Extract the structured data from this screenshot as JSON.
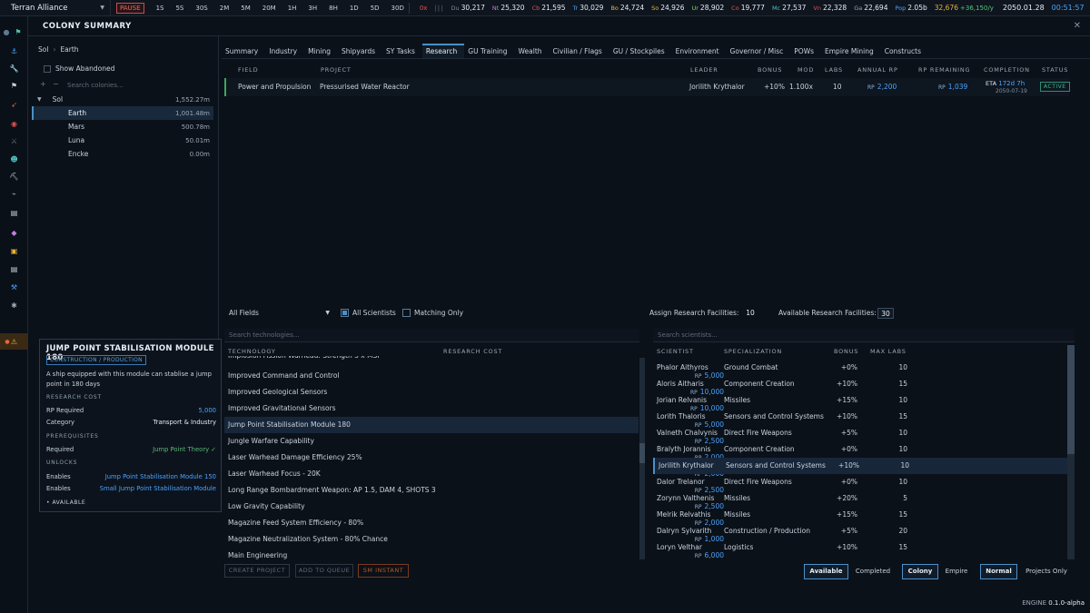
{
  "topbar": {
    "empire": "Terran Alliance",
    "pause": "PAUSE",
    "speeds": [
      "1S",
      "5S",
      "30S",
      "2M",
      "5M",
      "20M",
      "1H",
      "3H",
      "8H",
      "1D",
      "5D",
      "30D"
    ],
    "zero": "0x",
    "resources": [
      {
        "k": "Du",
        "v": "30,217",
        "color": "#7a8a99"
      },
      {
        "k": "Nt",
        "v": "25,320",
        "color": "#c77ddb"
      },
      {
        "k": "Cb",
        "v": "21,595",
        "color": "#e05252"
      },
      {
        "k": "Tr",
        "v": "30,029",
        "color": "#4ba3ff"
      },
      {
        "k": "Bo",
        "v": "24,724",
        "color": "#e8b339"
      },
      {
        "k": "So",
        "v": "24,926",
        "color": "#e8b339"
      },
      {
        "k": "Ur",
        "v": "28,902",
        "color": "#7bd66a"
      },
      {
        "k": "Co",
        "v": "19,777",
        "color": "#e05252"
      },
      {
        "k": "Mc",
        "v": "27,537",
        "color": "#4fc3c3"
      },
      {
        "k": "Vn",
        "v": "22,328",
        "color": "#e05252"
      },
      {
        "k": "Ga",
        "v": "22,694",
        "color": "#9aa8b5"
      },
      {
        "k": "Pop",
        "v": "2.05b",
        "color": "#4ba3ff"
      }
    ],
    "wealth": "32,676",
    "wealth_delta": "+36,150/y",
    "date": "2050.01.28",
    "time": "00:51:57"
  },
  "rail_icons": [
    "circle-icon",
    "flag-icon",
    "anchor-icon",
    "wrench-icon",
    "flag-small-icon",
    "rocket-icon",
    "target-icon",
    "crossed-swords-icon",
    "person-icon",
    "pickaxe-icon",
    "telescope-icon",
    "clipboard-icon",
    "tag-icon",
    "box-icon",
    "clipboard-2-icon",
    "tools-icon",
    "gear-icon",
    "warning-icon"
  ],
  "header": {
    "title": "COLONY SUMMARY",
    "close": "✕"
  },
  "colony": {
    "breadcrumb": [
      "Sol",
      "Earth"
    ],
    "show_abandoned": "Show Abandoned",
    "search_placeholder": "Search colonies...",
    "system": {
      "name": "Sol",
      "pop": "1,552.27m"
    },
    "bodies": [
      {
        "name": "Earth",
        "pop": "1,001.48m"
      },
      {
        "name": "Mars",
        "pop": "500.78m"
      },
      {
        "name": "Luna",
        "pop": "50.01m"
      },
      {
        "name": "Encke",
        "pop": "0.00m"
      }
    ]
  },
  "card": {
    "title": "JUMP POINT STABILISATION MODULE 180",
    "tag": "CONSTRUCTION / PRODUCTION",
    "desc": "A ship equipped with this module can stablise a jump point in 180 days",
    "sec_cost": "RESEARCH COST",
    "rp_label": "RP Required",
    "rp_value": "5,000",
    "cat_label": "Category",
    "cat_value": "Transport & Industry",
    "sec_prereq": "PREREQUISITES",
    "req_label": "Required",
    "req_value": "Jump Point Theory ✓",
    "sec_unlocks": "UNLOCKS",
    "enables": [
      {
        "label": "Enables",
        "value": "Jump Point Stabilisation Module 150"
      },
      {
        "label": "Enables",
        "value": "Small Jump Point Stabilisation Module"
      }
    ],
    "status": "AVAILABLE"
  },
  "tabs": [
    "Summary",
    "Industry",
    "Mining",
    "Shipyards",
    "SY Tasks",
    "Research",
    "GU Training",
    "Wealth",
    "Civilian / Flags",
    "GU / Stockpiles",
    "Environment",
    "Governor / Misc",
    "POWs",
    "Empire Mining",
    "Constructs"
  ],
  "projects": {
    "headers": [
      "FIELD",
      "PROJECT",
      "LEADER",
      "BONUS",
      "MOD",
      "LABS",
      "ANNUAL RP",
      "RP REMAINING",
      "COMPLETION",
      "STATUS"
    ],
    "rows": [
      {
        "field": "Power and Propulsion",
        "project": "Pressurised Water Reactor",
        "leader": "Jorilith Krythalor",
        "bonus": "+10%",
        "mod": "1.100x",
        "labs": "10",
        "annual_rp": "2,200",
        "rp_remaining": "1,039",
        "eta_label": "ETA",
        "eta": "172d 7h",
        "date": "2050-07-19",
        "status": "ACTIVE"
      }
    ]
  },
  "filters": {
    "field": "All Fields",
    "all_scientists": "All Scientists",
    "matching_only": "Matching Only",
    "assign_label": "Assign Research Facilities:",
    "assign_value": "10",
    "available_label": "Available Research Facilities:",
    "available_value": "30"
  },
  "techs": {
    "search_placeholder": "Search technologies...",
    "headers": [
      "TECHNOLOGY",
      "RESEARCH COST"
    ],
    "partial": "Implosion Fission Warhead: Strength 3 x MSP",
    "rows": [
      {
        "name": "Improved Command and Control",
        "cost": "5,000"
      },
      {
        "name": "Improved Geological Sensors",
        "cost": "10,000"
      },
      {
        "name": "Improved Gravitational Sensors",
        "cost": "10,000"
      },
      {
        "name": "Jump Point Stabilisation Module 180",
        "cost": "5,000"
      },
      {
        "name": "Jungle Warfare Capability",
        "cost": "2,500"
      },
      {
        "name": "Laser Warhead Damage Efficiency 25%",
        "cost": "2,000"
      },
      {
        "name": "Laser Warhead Focus - 20K",
        "cost": "2,000"
      },
      {
        "name": "Long Range Bombardment Weapon: AP 1.5, DAM 4, SHOTS 3",
        "cost": "2,500"
      },
      {
        "name": "Low Gravity Capability",
        "cost": "2,500"
      },
      {
        "name": "Magazine Feed System Efficiency - 80%",
        "cost": "2,000"
      },
      {
        "name": "Magazine Neutralization System - 80% Chance",
        "cost": "1,000"
      },
      {
        "name": "Main Engineering",
        "cost": "6,000"
      }
    ]
  },
  "scientists": {
    "search_placeholder": "Search scientists...",
    "headers": [
      "SCIENTIST",
      "SPECIALIZATION",
      "BONUS",
      "MAX LABS"
    ],
    "rows": [
      {
        "name": "Phalor Aithyros",
        "spec": "Ground Combat",
        "bonus": "+0%",
        "labs": "10"
      },
      {
        "name": "Aloris Aitharis",
        "spec": "Component Creation",
        "bonus": "+10%",
        "labs": "15"
      },
      {
        "name": "Jorian Relvanis",
        "spec": "Missiles",
        "bonus": "+15%",
        "labs": "10"
      },
      {
        "name": "Lorith Thaloris",
        "spec": "Sensors and Control Systems",
        "bonus": "+10%",
        "labs": "15"
      },
      {
        "name": "Valneth Chalvynis",
        "spec": "Direct Fire Weapons",
        "bonus": "+5%",
        "labs": "10"
      },
      {
        "name": "Bralyth Jorannis",
        "spec": "Component Creation",
        "bonus": "+0%",
        "labs": "10"
      },
      {
        "name": "Jorilith Krythalor",
        "spec": "Sensors and Control Systems",
        "bonus": "+10%",
        "labs": "10"
      },
      {
        "name": "Dalor Trelanor",
        "spec": "Direct Fire Weapons",
        "bonus": "+0%",
        "labs": "10"
      },
      {
        "name": "Zorynn Valthenis",
        "spec": "Missiles",
        "bonus": "+20%",
        "labs": "5"
      },
      {
        "name": "Melrik Relvathis",
        "spec": "Missiles",
        "bonus": "+15%",
        "labs": "15"
      },
      {
        "name": "Dalryn Sylvarith",
        "spec": "Construction / Production",
        "bonus": "+5%",
        "labs": "20"
      },
      {
        "name": "Loryn Velthar",
        "spec": "Logistics",
        "bonus": "+10%",
        "labs": "15"
      }
    ]
  },
  "actions": {
    "create": "CREATE PROJECT",
    "queue": "ADD TO QUEUE",
    "instant": "SM INSTANT",
    "available": "Available",
    "completed": "Completed",
    "colony": "Colony",
    "empire": "Empire",
    "normal": "Normal",
    "projects_only": "Projects Only"
  },
  "engine": "ENGINE",
  "version": "0.1.0-alpha"
}
